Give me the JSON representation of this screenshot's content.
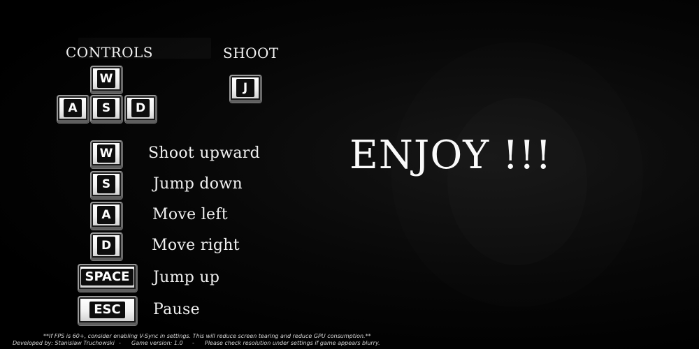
{
  "controls_heading": "CONTROLS",
  "shoot_heading": "SHOOT",
  "movement_keys": {
    "w": "W",
    "a": "A",
    "s": "S",
    "d": "D"
  },
  "shoot_key": "J",
  "bindings": [
    {
      "key": "W",
      "action": "Shoot upward"
    },
    {
      "key": "S",
      "action": "Jump down"
    },
    {
      "key": "A",
      "action": "Move left"
    },
    {
      "key": "D",
      "action": "Move right"
    },
    {
      "key": "SPACE",
      "action": "Jump up"
    },
    {
      "key": "ESC",
      "action": "Pause"
    }
  ],
  "enjoy_text": "ENJOY !!!",
  "footer": {
    "note": "**If FPS is 60+, consider enabling V-Sync in settings. This will reduce screen tearing and reduce GPU consumption.**",
    "developer": "Developed by: Stanislaw Truchowski",
    "separator": "-",
    "version": "Game version: 1.0",
    "resolution_hint": "Please check resolution under settings if game appears blurry."
  }
}
